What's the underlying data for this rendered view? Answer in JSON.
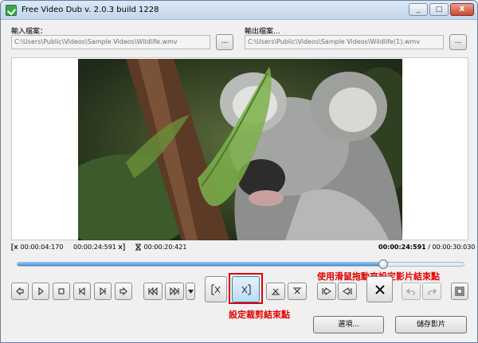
{
  "window": {
    "title": "Free Video Dub  v. 2.0.3 build 1228",
    "min_label": "_",
    "max_label": "□",
    "close_label": "X"
  },
  "input": {
    "label": "輸入檔案：",
    "path": "C:\\Users\\Public\\Videos\\Sample Videos\\Wildlife.wmv",
    "browse_label": "..."
  },
  "output": {
    "label": "輸出檔案...",
    "path": "C:\\Users\\Public\\Videos\\Sample Videos\\Wildlife(1).wmv",
    "browse_label": "..."
  },
  "timeline": {
    "start_time": "00:00:04:170",
    "end_time": "00:00:24:591",
    "cut_length": "00:00:20:421",
    "current_time": "00:00:24:591",
    "separator": "/",
    "total_time": "00:00:30:030",
    "progress": 0.82
  },
  "annotations": {
    "drag_hint": "使用滑鼠拖動來設定影片結束點",
    "end_point_hint": "設定裁剪結束點"
  },
  "buttons": {
    "options_label": "選項...",
    "save_label": "儲存影片"
  },
  "colors": {
    "accent": "#3a8ee0",
    "annotation": "#e00000"
  }
}
